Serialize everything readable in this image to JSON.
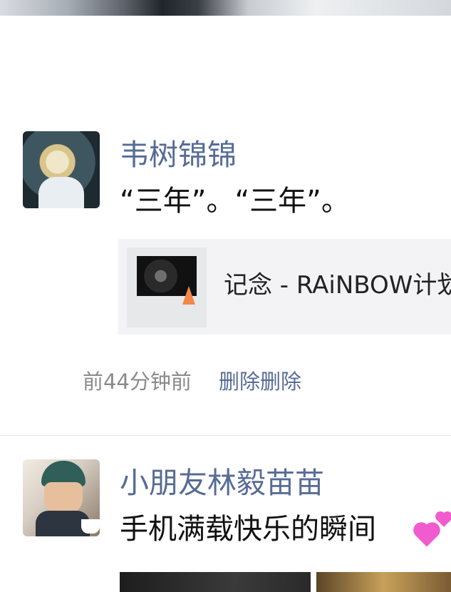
{
  "posts": [
    {
      "author": "韦树锦锦",
      "text": "“三年”。“三年”。",
      "link_title": "记念 - RAiNBOW计划",
      "time": "前44分钟前",
      "delete_label": "删除删除"
    },
    {
      "author": "小朋友林毅苗苗",
      "text": "手机满载快乐的瞬间"
    }
  ],
  "icons": {
    "heart": "heart-icon"
  },
  "colors": {
    "link_name": "#576b95",
    "meta": "#8a8a8a",
    "heart": "#f25bd0"
  }
}
